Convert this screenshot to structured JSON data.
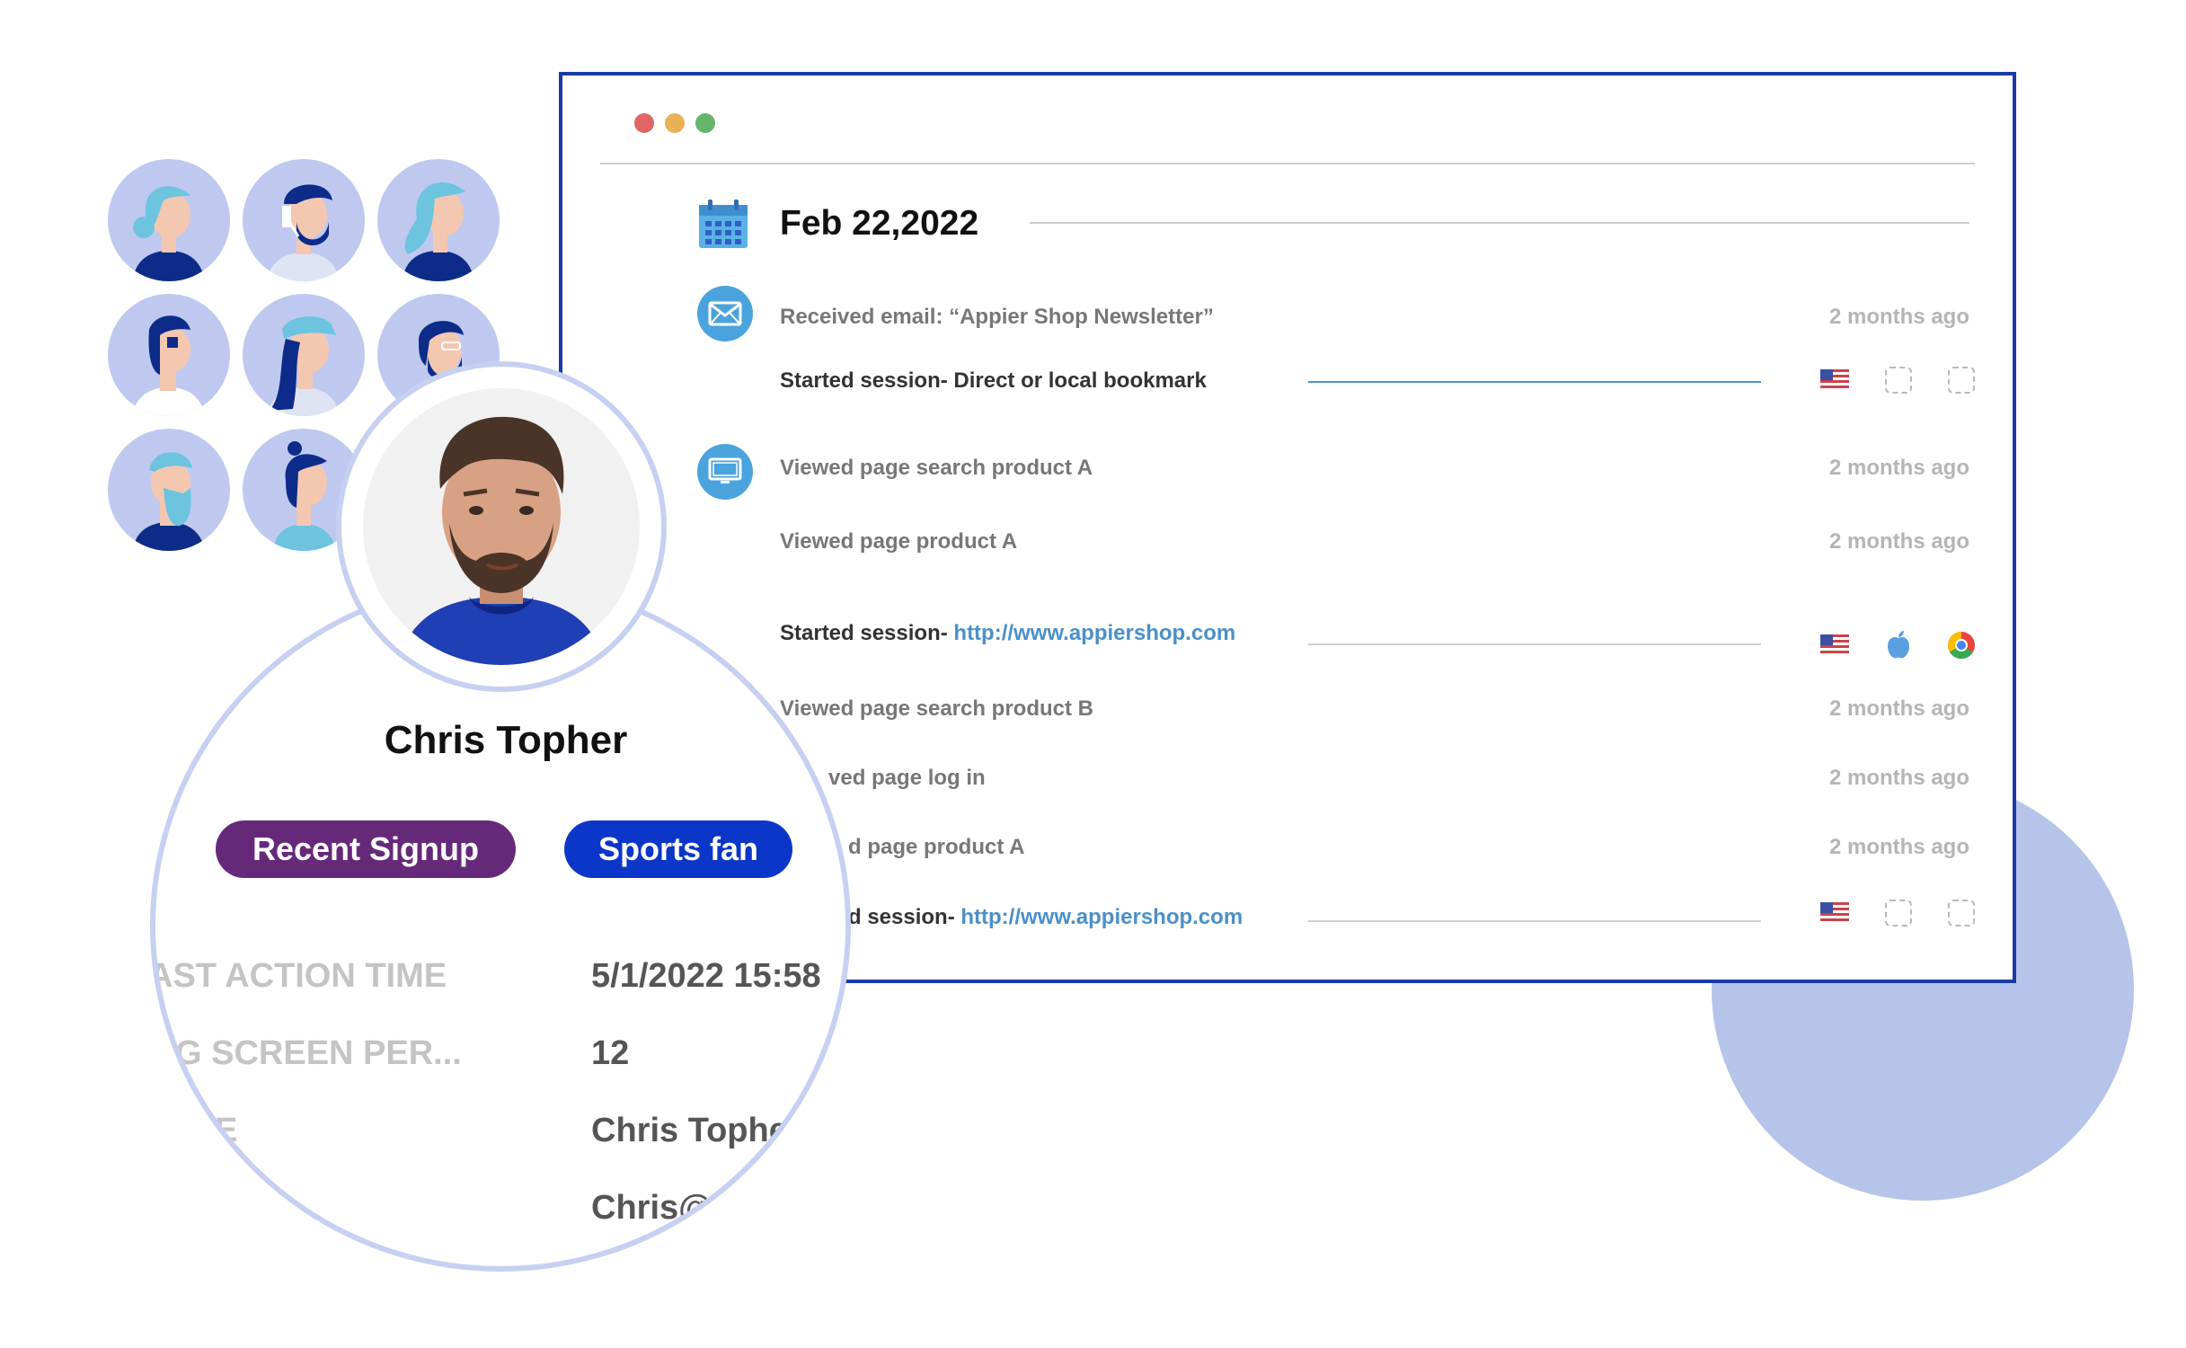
{
  "timeline": {
    "date": "Feb 22,2022",
    "events": [
      {
        "text": "Received email: “Appier Shop Newsletter”",
        "time": "2 months ago",
        "icon": "envelope-icon"
      },
      {
        "text": "Started session- Direct or local bookmark",
        "flags": [
          "us-flag-icon",
          "placeholder-icon",
          "placeholder-icon"
        ]
      },
      {
        "text": "Viewed page search product A",
        "time": "2 months ago",
        "icon": "monitor-icon"
      },
      {
        "text": "Viewed page product A",
        "time": "2 months ago"
      },
      {
        "prefix": "Started session- ",
        "link": "http://www.appiershop.com",
        "flags": [
          "us-flag-icon",
          "apple-icon",
          "chrome-icon"
        ]
      },
      {
        "text": "Viewed page search product B",
        "time": "2 months ago"
      },
      {
        "text": "ved page log in",
        "time": "2 months ago"
      },
      {
        "text": "d page product A",
        "time": "2 months ago"
      },
      {
        "prefix": "d session- ",
        "link": "http://www.appiershop.com",
        "flags": [
          "us-flag-icon",
          "placeholder-icon",
          "placeholder-icon"
        ]
      }
    ]
  },
  "profile": {
    "name": "Chris Topher",
    "tags": [
      "Recent Signup",
      "Sports fan"
    ],
    "attributes": [
      {
        "label": "AST ACTION TIME",
        "value": "5/1/2022 15:58"
      },
      {
        "label": "G SCREEN PER...",
        "value": "12"
      },
      {
        "label": "E",
        "value": "Chris Topher"
      },
      {
        "label": "",
        "value": "Chris@a"
      }
    ]
  },
  "colors": {
    "window_border": "#1b3aa8",
    "tag_purple": "#66297a",
    "tag_blue": "#0b36c8",
    "link": "#4a90c9",
    "accent_circle": "#b6c4ea"
  }
}
